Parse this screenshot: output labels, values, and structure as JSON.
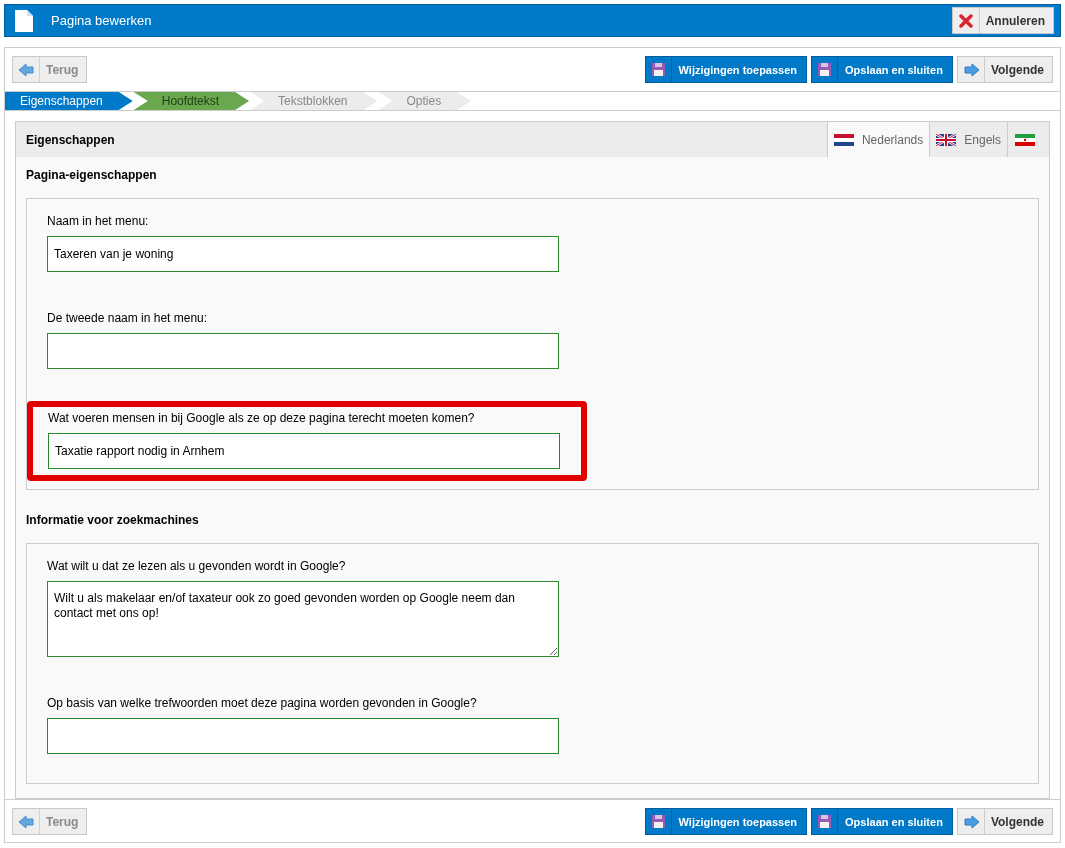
{
  "header": {
    "title": "Pagina bewerken",
    "cancel_button": "Annuleren"
  },
  "toolbar_top": {
    "back": {
      "label": "Terug",
      "disabled": true
    },
    "apply": "Wijzigingen toepassen",
    "save_close": "Opslaan en sluiten",
    "next": "Volgende"
  },
  "steps": [
    {
      "label": "Eigenschappen",
      "selected": true,
      "completed": false
    },
    {
      "label": "Hoofdtekst",
      "selected": false,
      "completed": true
    },
    {
      "label": "Tekstblokken",
      "selected": false,
      "completed": false
    },
    {
      "label": "Opties",
      "selected": false,
      "completed": false
    }
  ],
  "panel": {
    "title": "Eigenschappen",
    "language_tabs": [
      {
        "label": "Nederlands",
        "kind": "dutch",
        "selected": true
      },
      {
        "label": "Engels",
        "kind": "british",
        "selected": false
      },
      {
        "kind": "iranian",
        "selected": false
      }
    ],
    "sections": [
      {
        "title": "Pagina-eigenschappen",
        "fields": [
          {
            "label": "Naam in het menu:",
            "kind": "input",
            "value": "Taxeren van je woning",
            "highlighted": false
          },
          {
            "label": "De tweede naam in het menu:",
            "kind": "input",
            "highlighted": false
          },
          {
            "label": "Wat voeren mensen in bij Google als ze op deze pagina terecht moeten komen?",
            "kind": "input",
            "value": "Taxatie rapport nodig in Arnhem",
            "highlighted": true
          }
        ]
      },
      {
        "title": "Informatie voor zoekmachines",
        "fields": [
          {
            "label": "Wat wilt u dat ze lezen als u gevonden wordt in Google?",
            "kind": "textarea",
            "value": "Wilt u als makelaar en/of taxateur ook zo goed gevonden worden op Google neem dan contact met ons op!",
            "highlighted": false
          },
          {
            "label": "Op basis van welke trefwoorden moet deze pagina worden gevonden in Google?",
            "kind": "input",
            "highlighted": false
          }
        ]
      }
    ]
  },
  "toolbar_bottom": {
    "back": {
      "label": "Terug",
      "disabled": true
    },
    "apply": "Wijzigingen toepassen",
    "save_close": "Opslaan en sluiten",
    "next": "Volgende"
  }
}
